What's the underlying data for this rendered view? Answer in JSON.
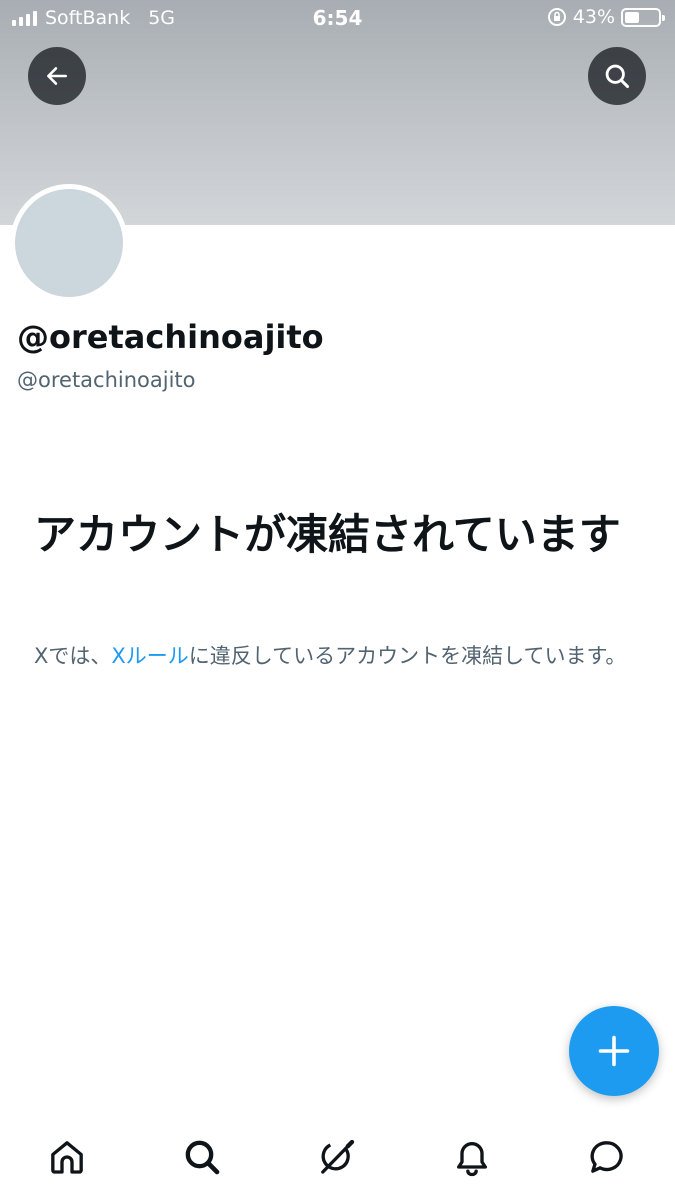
{
  "status_bar": {
    "carrier": "SoftBank",
    "network": "5G",
    "time": "6:54",
    "battery_percent": "43%",
    "battery_level": 0.43
  },
  "header": {
    "back_icon": "arrow-left-icon",
    "search_icon": "search-icon"
  },
  "profile": {
    "display_name": "@oretachinoajito",
    "handle": "@oretachinoajito"
  },
  "suspension": {
    "title": "アカウントが凍結されています",
    "desc_prefix": "Xでは、",
    "rules_link": "Xルール",
    "desc_suffix": "に違反しているアカウントを凍結しています。"
  },
  "fab": {
    "icon": "plus-icon"
  },
  "tab_bar": {
    "items": [
      "home-icon",
      "search-icon",
      "grok-icon",
      "bell-icon",
      "message-icon"
    ]
  },
  "colors": {
    "accent": "#1d9bf0",
    "text_primary": "#0f1419",
    "text_secondary": "#536471",
    "avatar_placeholder": "#ccd6dd"
  }
}
